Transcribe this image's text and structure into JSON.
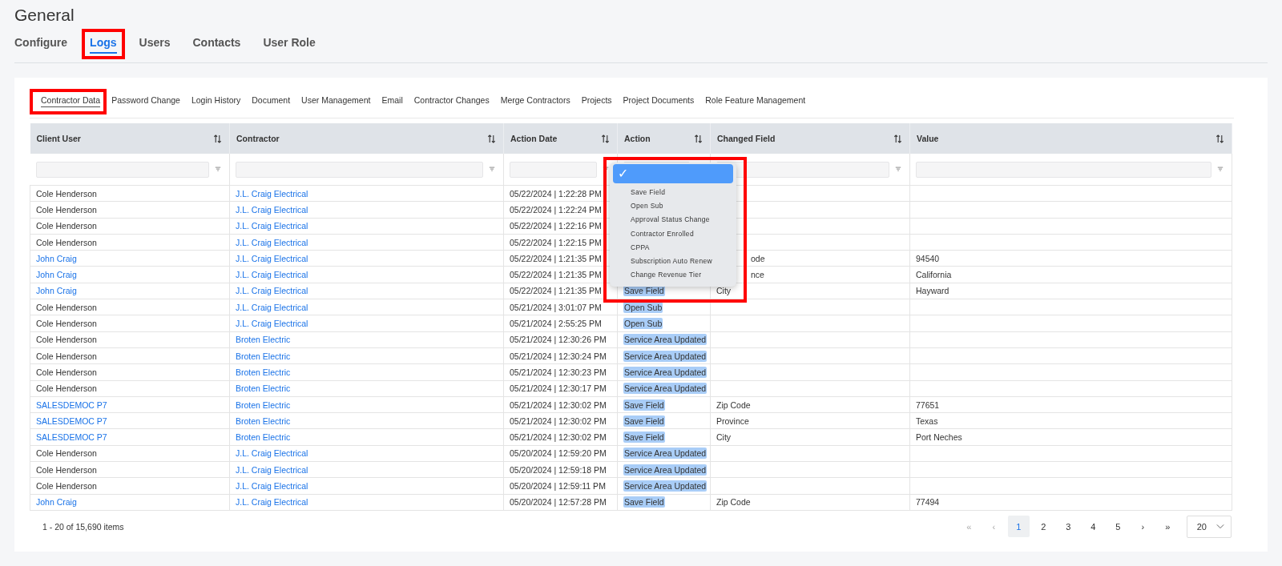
{
  "page": {
    "title": "General"
  },
  "tabs": [
    {
      "label": "Configure",
      "selected": false,
      "highlighted": false
    },
    {
      "label": "Logs",
      "selected": true,
      "highlighted": true
    },
    {
      "label": "Users",
      "selected": false,
      "highlighted": false
    },
    {
      "label": "Contacts",
      "selected": false,
      "highlighted": false
    },
    {
      "label": "User Role",
      "selected": false,
      "highlighted": false
    }
  ],
  "subtabs": [
    {
      "label": "Contractor Data",
      "selected": true,
      "highlighted": true
    },
    {
      "label": "Password Change",
      "selected": false,
      "highlighted": false
    },
    {
      "label": "Login History",
      "selected": false,
      "highlighted": false
    },
    {
      "label": "Document",
      "selected": false,
      "highlighted": false
    },
    {
      "label": "User Management",
      "selected": false,
      "highlighted": false
    },
    {
      "label": "Email",
      "selected": false,
      "highlighted": false
    },
    {
      "label": "Contractor Changes",
      "selected": false,
      "highlighted": false
    },
    {
      "label": "Merge Contractors",
      "selected": false,
      "highlighted": false
    },
    {
      "label": "Projects",
      "selected": false,
      "highlighted": false
    },
    {
      "label": "Project Documents",
      "selected": false,
      "highlighted": false
    },
    {
      "label": "Role Feature Management",
      "selected": false,
      "highlighted": false
    }
  ],
  "table": {
    "columns": [
      "Client User",
      "Contractor",
      "Action Date",
      "Action",
      "Changed Field",
      "Value"
    ],
    "rows": [
      {
        "client_user": "Cole Henderson",
        "client_user_link": false,
        "contractor": "J.L. Craig Electrical",
        "action_date": "05/22/2024 | 1:22:28 PM"
      },
      {
        "client_user": "Cole Henderson",
        "client_user_link": false,
        "contractor": "J.L. Craig Electrical",
        "action_date": "05/22/2024 | 1:22:24 PM"
      },
      {
        "client_user": "Cole Henderson",
        "client_user_link": false,
        "contractor": "J.L. Craig Electrical",
        "action_date": "05/22/2024 | 1:22:16 PM"
      },
      {
        "client_user": "Cole Henderson",
        "client_user_link": false,
        "contractor": "J.L. Craig Electrical",
        "action_date": "05/22/2024 | 1:22:15 PM"
      },
      {
        "client_user": "John Craig",
        "client_user_link": true,
        "contractor": "J.L. Craig Electrical",
        "action_date": "05/22/2024 | 1:21:35 PM",
        "changed_field": "ode",
        "changed_field_covered": true,
        "value": "94540"
      },
      {
        "client_user": "John Craig",
        "client_user_link": true,
        "contractor": "J.L. Craig Electrical",
        "action_date": "05/22/2024 | 1:21:35 PM",
        "changed_field": "nce",
        "changed_field_covered": true,
        "value": "California"
      },
      {
        "client_user": "John Craig",
        "client_user_link": true,
        "contractor": "J.L. Craig Electrical",
        "action_date": "05/22/2024 | 1:21:35 PM",
        "action": "Save Field",
        "changed_field": "City",
        "changed_field_covered": false,
        "value": "Hayward"
      },
      {
        "client_user": "Cole Henderson",
        "client_user_link": false,
        "contractor": "J.L. Craig Electrical",
        "action_date": "05/21/2024 | 3:01:07 PM",
        "action": "Open Sub"
      },
      {
        "client_user": "Cole Henderson",
        "client_user_link": false,
        "contractor": "J.L. Craig Electrical",
        "action_date": "05/21/2024 | 2:55:25 PM",
        "action": "Open Sub"
      },
      {
        "client_user": "Cole Henderson",
        "client_user_link": false,
        "contractor": "Broten Electric",
        "action_date": "05/21/2024 | 12:30:26 PM",
        "action": "Service Area Updated"
      },
      {
        "client_user": "Cole Henderson",
        "client_user_link": false,
        "contractor": "Broten Electric",
        "action_date": "05/21/2024 | 12:30:24 PM",
        "action": "Service Area Updated"
      },
      {
        "client_user": "Cole Henderson",
        "client_user_link": false,
        "contractor": "Broten Electric",
        "action_date": "05/21/2024 | 12:30:23 PM",
        "action": "Service Area Updated"
      },
      {
        "client_user": "Cole Henderson",
        "client_user_link": false,
        "contractor": "Broten Electric",
        "action_date": "05/21/2024 | 12:30:17 PM",
        "action": "Service Area Updated"
      },
      {
        "client_user": "SALESDEMOC P7",
        "client_user_link": true,
        "contractor": "Broten Electric",
        "action_date": "05/21/2024 | 12:30:02 PM",
        "action": "Save Field",
        "changed_field": "Zip Code",
        "changed_field_covered": false,
        "value": "77651"
      },
      {
        "client_user": "SALESDEMOC P7",
        "client_user_link": true,
        "contractor": "Broten Electric",
        "action_date": "05/21/2024 | 12:30:02 PM",
        "action": "Save Field",
        "changed_field": "Province",
        "changed_field_covered": false,
        "value": "Texas"
      },
      {
        "client_user": "SALESDEMOC P7",
        "client_user_link": true,
        "contractor": "Broten Electric",
        "action_date": "05/21/2024 | 12:30:02 PM",
        "action": "Save Field",
        "changed_field": "City",
        "changed_field_covered": false,
        "value": "Port Neches"
      },
      {
        "client_user": "Cole Henderson",
        "client_user_link": false,
        "contractor": "J.L. Craig Electrical",
        "action_date": "05/20/2024 | 12:59:20 PM",
        "action": "Service Area Updated"
      },
      {
        "client_user": "Cole Henderson",
        "client_user_link": false,
        "contractor": "J.L. Craig Electrical",
        "action_date": "05/20/2024 | 12:59:18 PM",
        "action": "Service Area Updated"
      },
      {
        "client_user": "Cole Henderson",
        "client_user_link": false,
        "contractor": "J.L. Craig Electrical",
        "action_date": "05/20/2024 | 12:59:11 PM",
        "action": "Service Area Updated"
      },
      {
        "client_user": "John Craig",
        "client_user_link": true,
        "contractor": "J.L. Craig Electrical",
        "action_date": "05/20/2024 | 12:57:28 PM",
        "action": "Save Field",
        "changed_field": "Zip Code",
        "changed_field_covered": false,
        "value": "77494"
      }
    ]
  },
  "action_filter_dropdown": {
    "highlighted": true,
    "options": [
      {
        "label": "✓",
        "selected": true
      },
      {
        "label": "Save Field",
        "selected": false
      },
      {
        "label": "Open Sub",
        "selected": false
      },
      {
        "label": "Approval Status Change",
        "selected": false
      },
      {
        "label": "Contractor Enrolled",
        "selected": false
      },
      {
        "label": "CPPA",
        "selected": false
      },
      {
        "label": "Subscription Auto Renew",
        "selected": false
      },
      {
        "label": "Change Revenue Tier",
        "selected": false
      }
    ]
  },
  "footer": {
    "summary": "1 - 20 of 15,690 items",
    "first": "«",
    "prev": "‹",
    "pages": [
      {
        "label": "1",
        "selected": true
      },
      {
        "label": "2",
        "selected": false
      },
      {
        "label": "3",
        "selected": false
      },
      {
        "label": "4",
        "selected": false
      },
      {
        "label": "5",
        "selected": false
      }
    ],
    "next": "›",
    "last": "»",
    "page_size": "20"
  }
}
